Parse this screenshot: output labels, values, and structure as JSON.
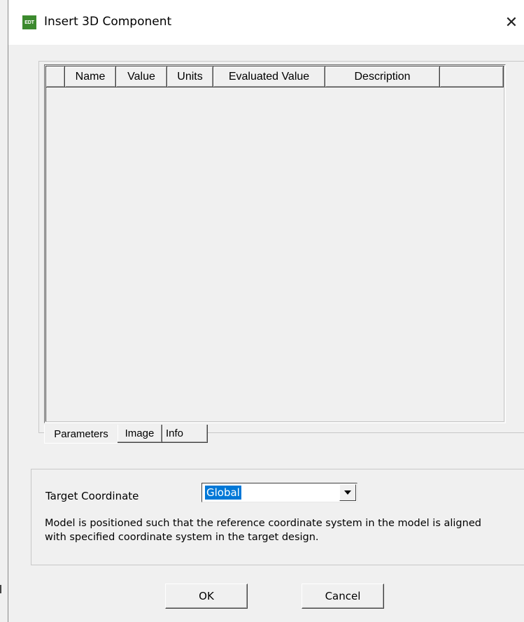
{
  "window": {
    "title": "Insert 3D Component",
    "icon_text": "EDT",
    "icon_color": "#3c8a2e",
    "close_icon": "close-icon"
  },
  "grid": {
    "columns": [
      "",
      "Name",
      "Value",
      "Units",
      "Evaluated Value",
      "Description",
      ""
    ],
    "rows": []
  },
  "tabs": [
    {
      "label": "Parameters",
      "active": true
    },
    {
      "label": "Image",
      "active": false
    },
    {
      "label": "Info",
      "active": false
    }
  ],
  "target": {
    "label": "Target Coordinate",
    "selected": "Global",
    "description": "Model is positioned such that the reference coordinate system in the model is aligned with specified coordinate system in the target design."
  },
  "buttons": {
    "ok": "OK",
    "cancel": "Cancel"
  },
  "colors": {
    "selection": "#0078d7",
    "background": "#f0f0f0"
  }
}
